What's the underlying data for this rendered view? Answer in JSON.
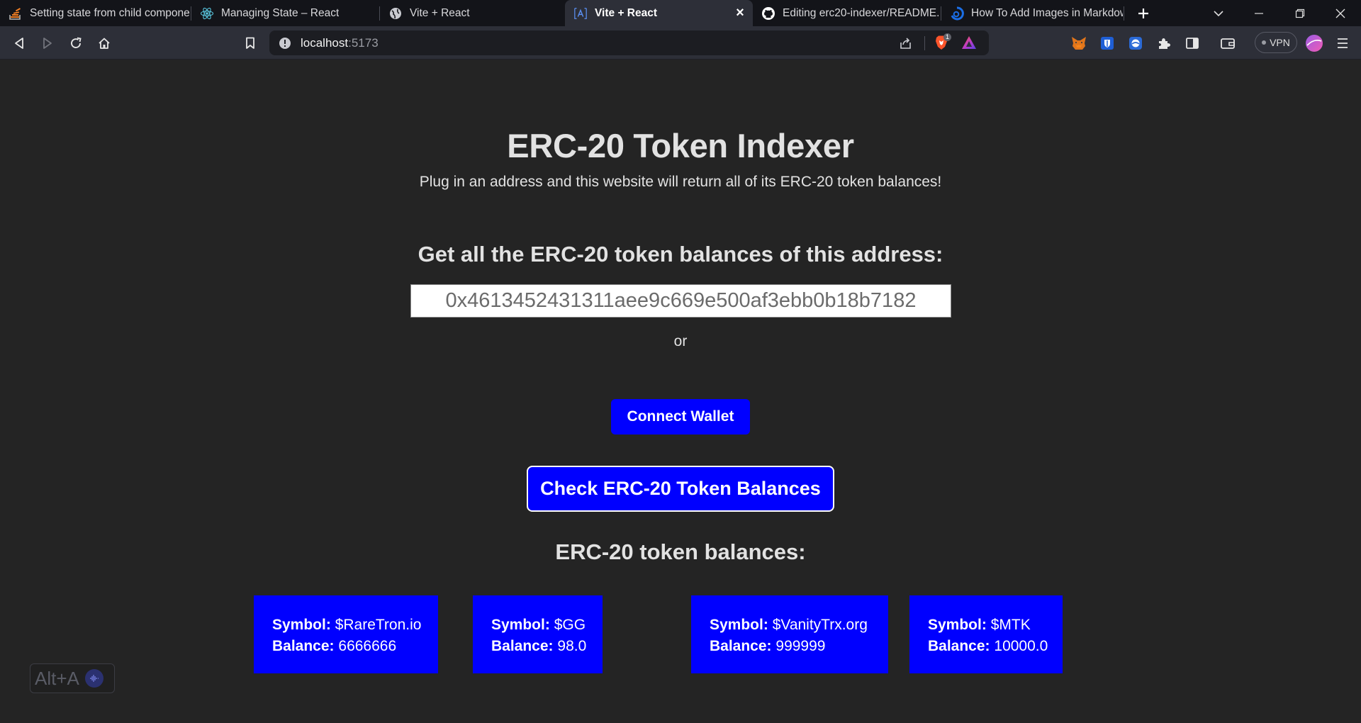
{
  "tabs": [
    {
      "label": "Setting state from child compone",
      "icon": "stackoverflow-icon"
    },
    {
      "label": "Managing State – React",
      "icon": "react-icon"
    },
    {
      "label": "Vite + React",
      "icon": "globe-icon"
    },
    {
      "label": "Vite + React",
      "icon": "vite-icon"
    },
    {
      "label": "Editing erc20-indexer/README.r",
      "icon": "github-icon"
    },
    {
      "label": "How To Add Images in Markdow",
      "icon": "site-icon"
    }
  ],
  "address_bar": {
    "host": "localhost",
    "port": ":5173"
  },
  "vpn_label": "VPN",
  "brave_badge": "1",
  "page": {
    "title": "ERC-20 Token Indexer",
    "subtitle": "Plug in an address and this website will return all of its ERC-20 token balances!",
    "question": "Get all the ERC-20 token balances of this address:",
    "address_value": "0x4613452431311aee9c669e500af3ebb0b18b7182",
    "or_text": "or",
    "connect_label": "Connect Wallet",
    "check_label": "Check ERC-20 Token Balances",
    "balances_heading": "ERC-20 token balances:",
    "symbol_label": "Symbol:",
    "balance_label": "Balance:",
    "tokens": [
      {
        "symbol": "$RareTron.io",
        "balance": "6666666"
      },
      {
        "symbol": "$GG",
        "balance": "98.0"
      },
      {
        "symbol": "$VanityTrx.org",
        "balance": "999999"
      },
      {
        "symbol": "$MTK",
        "balance": "10000.0"
      }
    ]
  },
  "shortcut_hint": "Alt+A",
  "colors": {
    "accent_blue": "#0000ff",
    "page_bg": "#242424",
    "tabstrip_bg": "#131419",
    "toolbar_bg": "#2d2f38"
  }
}
